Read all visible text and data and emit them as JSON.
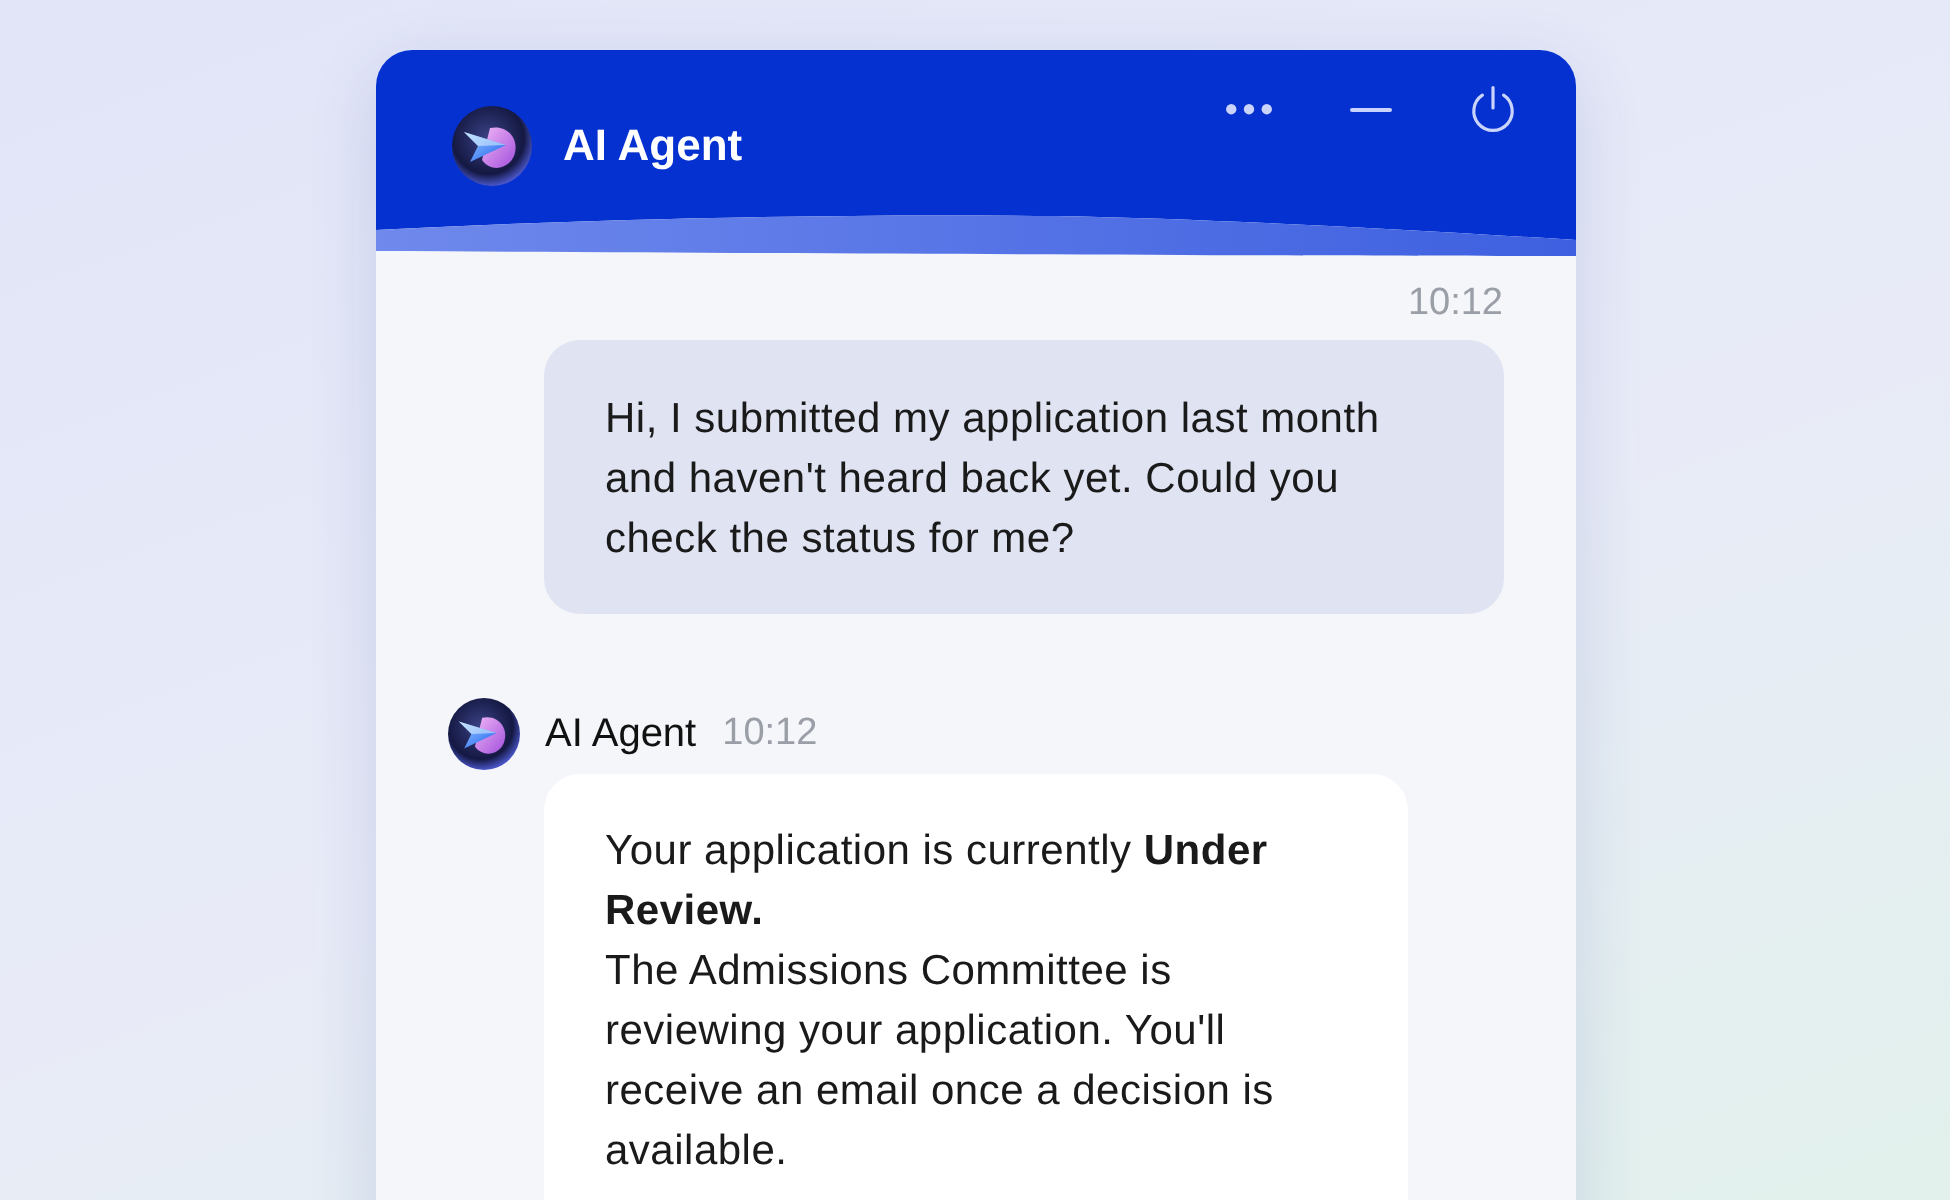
{
  "header": {
    "title": "AI Agent"
  },
  "messages": [
    {
      "kind": "user",
      "time": "10:12",
      "paragraphs": [
        "Hi, I submitted my application last month and haven't heard back yet. Could you check the status for me?"
      ]
    },
    {
      "kind": "agent",
      "sender": "AI Agent",
      "time": "10:12",
      "paragraphs": [
        "Your application is currently **Under Review.**",
        "The Admissions Committee is reviewing your application. You'll receive an email once a decision is available."
      ]
    }
  ]
}
